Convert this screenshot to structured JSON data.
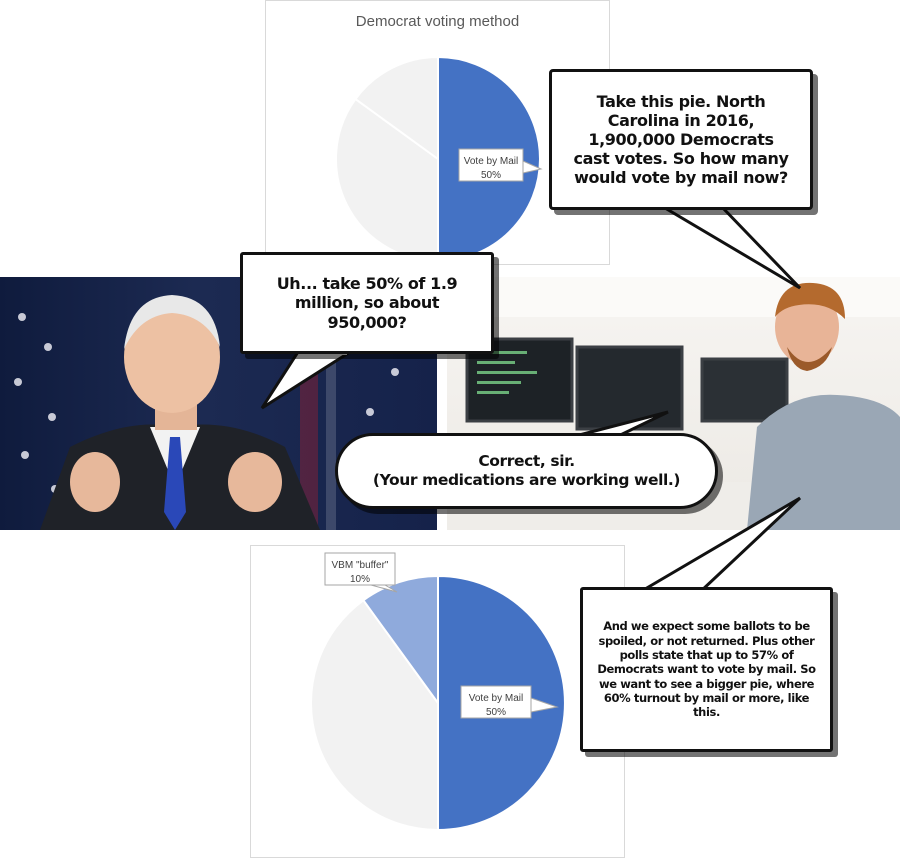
{
  "top_chart": {
    "title": "Democrat voting method",
    "chart_data": {
      "type": "pie",
      "title": "Democrat voting method",
      "slices": [
        {
          "label": "Vote by Mail",
          "value": 50,
          "display": "50%",
          "color": "#4472c4",
          "labeled": true
        },
        {
          "label": "",
          "value": 35,
          "color": "#f2f2f2",
          "labeled": false
        },
        {
          "label": "",
          "value": 15,
          "color": "#f2f2f2",
          "labeled": false
        }
      ]
    }
  },
  "bottom_chart": {
    "chart_data": {
      "type": "pie",
      "slices": [
        {
          "label": "Vote by Mail",
          "value": 50,
          "display": "50%",
          "color": "#4472c4",
          "labeled": true
        },
        {
          "label": "",
          "value": 40,
          "color": "#f2f2f2",
          "labeled": false
        },
        {
          "label": "VBM \"buffer\"",
          "value": 10,
          "display": "10%",
          "color": "#8faadc",
          "labeled": true
        }
      ]
    }
  },
  "bubbles": {
    "analyst_question": "Take this pie. North Carolina in 2016, 1,900,000 Democrats cast votes. So how many would vote by mail now?",
    "biden_answer": "Uh... take 50% of 1.9 million, so about 950,000?",
    "analyst_reply_line1": "Correct, sir.",
    "analyst_reply_line2": "(Your medications are working well.)",
    "analyst_explanation": "And we expect some ballots to be spoiled, or not returned. Plus other polls state that up to 57% of Democrats want to vote by mail. So we want to see a bigger pie, where 60% turnout by mail or more, like this."
  },
  "colors": {
    "vote_by_mail_blue": "#4472c4",
    "buffer_light_blue": "#8faadc",
    "other_gray": "#f2f2f2",
    "stage_navy": "#1c2a52",
    "office_white": "#f4f2ef"
  },
  "icons": [
    "flag-stars",
    "computer-monitor"
  ]
}
